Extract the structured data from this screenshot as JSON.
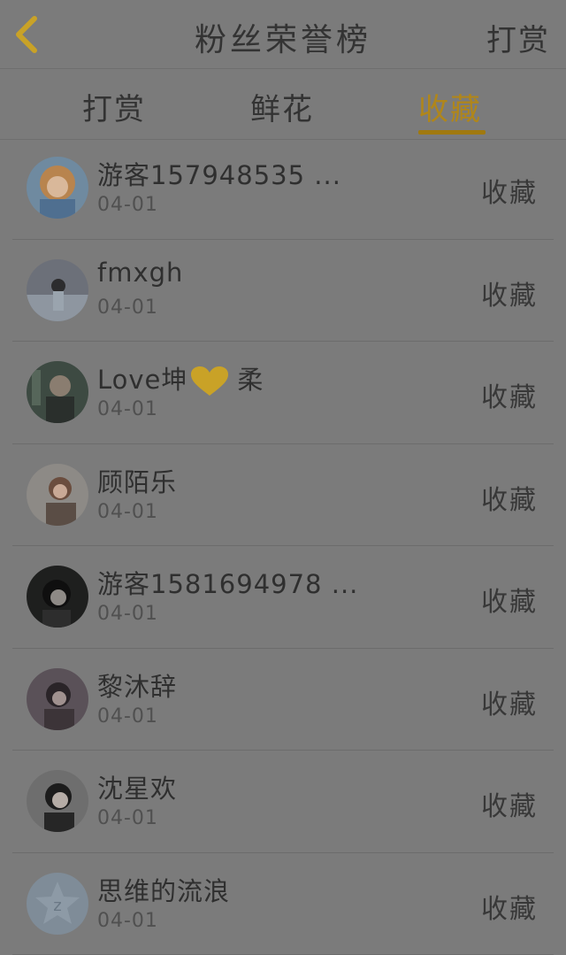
{
  "header": {
    "title": "粉丝荣誉榜",
    "action_label": "打赏",
    "back_icon": "chevron-left-icon",
    "back_color": "#c9a227"
  },
  "tabs": [
    {
      "label": "打赏",
      "active": false
    },
    {
      "label": "鲜花",
      "active": false
    },
    {
      "label": "收藏",
      "active": true
    }
  ],
  "accent_color": "#b0861a",
  "fans": [
    {
      "name": "游客157948535 ...",
      "date": "04-01",
      "action": "收藏"
    },
    {
      "name": "fmxgh",
      "date": "04-01",
      "action": "收藏"
    },
    {
      "name_prefix": "Love坤",
      "name_suffix": "柔",
      "has_heart": true,
      "date": "04-01",
      "action": "收藏"
    },
    {
      "name": "顾陌乐",
      "date": "04-01",
      "action": "收藏"
    },
    {
      "name": "游客1581694978 ...",
      "date": "04-01",
      "action": "收藏"
    },
    {
      "name": "黎沐辞",
      "date": "04-01",
      "action": "收藏"
    },
    {
      "name": "沈星欢",
      "date": "04-01",
      "action": "收藏"
    },
    {
      "name": "思维的流浪",
      "date": "04-01",
      "action": "收藏"
    }
  ]
}
